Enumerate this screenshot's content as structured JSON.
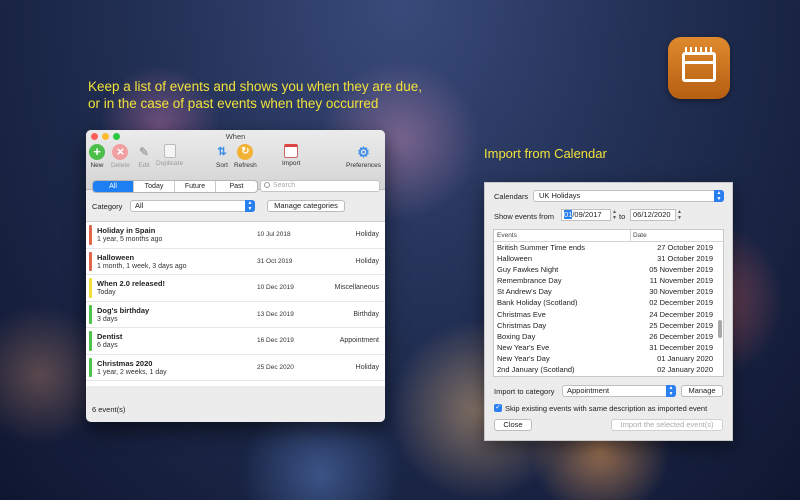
{
  "promo": {
    "headline_line1": "Keep a list of events and shows you when they are due,",
    "headline_line2": "or in the case of past events when they occurred",
    "import_heading": "Import from Calendar"
  },
  "app_icon": "calendar-icon",
  "colors": {
    "headline": "#f2e23a",
    "accent": "#1e7ff2",
    "app_icon": "#d2741f"
  },
  "main_window": {
    "title": "When",
    "toolbar": [
      {
        "label": "New",
        "icon": "plus-circle-icon",
        "enabled": true
      },
      {
        "label": "Delete",
        "icon": "x-circle-icon",
        "enabled": false
      },
      {
        "label": "Edit",
        "icon": "pencil-icon",
        "enabled": false
      },
      {
        "label": "Duplicate",
        "icon": "duplicate-icon",
        "enabled": false
      },
      {
        "label": "Sort",
        "icon": "sort-icon",
        "enabled": true
      },
      {
        "label": "Refresh",
        "icon": "refresh-icon",
        "enabled": true
      },
      {
        "label": "Import",
        "icon": "calendar-import-icon",
        "enabled": true
      },
      {
        "label": "Preferences",
        "icon": "gear-icon",
        "enabled": true
      }
    ],
    "filters": [
      "All",
      "Today",
      "Future",
      "Past"
    ],
    "active_filter": "All",
    "search_placeholder": "Search",
    "category_label": "Category",
    "category_value": "All",
    "manage_categories": "Manage categories",
    "events": [
      {
        "title": "Holiday in Spain",
        "relative": "1 year, 5 months ago",
        "date": "10 Jul 2018",
        "category": "Holiday",
        "color": "#e0664b"
      },
      {
        "title": "Halloween",
        "relative": "1 month, 1 week, 3 days ago",
        "date": "31 Oct 2019",
        "category": "Holiday",
        "color": "#e0664b"
      },
      {
        "title": "When 2.0 released!",
        "relative": "Today",
        "date": "10 Dec 2019",
        "category": "Miscellaneous",
        "color": "#f0de3a"
      },
      {
        "title": "Dog's birthday",
        "relative": "3 days",
        "date": "13 Dec 2019",
        "category": "Birthday",
        "color": "#4cc24a"
      },
      {
        "title": "Dentist",
        "relative": "6 days",
        "date": "16 Dec 2019",
        "category": "Appointment",
        "color": "#4cc24a"
      },
      {
        "title": "Christmas 2020",
        "relative": "1 year, 2 weeks, 1 day",
        "date": "25 Dec 2020",
        "category": "Holiday",
        "color": "#4cc24a"
      }
    ],
    "footer": "6 event(s)"
  },
  "import_window": {
    "calendars_label": "Calendars",
    "calendar_value": "UK Holidays",
    "show_events_label": "Show events from",
    "from_day_highlight": "01",
    "from_rest": "/09/2017",
    "to_label": "to",
    "to_date": "06/12/2020",
    "col_events": "Events",
    "col_date": "Date",
    "events": [
      {
        "name": "British Summer Time ends",
        "date": "27 October 2019"
      },
      {
        "name": "Halloween",
        "date": "31 October 2019"
      },
      {
        "name": "Guy Fawkes Night",
        "date": "05 November 2019"
      },
      {
        "name": "Remembrance Day",
        "date": "11 November 2019"
      },
      {
        "name": "St Andrew's Day",
        "date": "30 November 2019"
      },
      {
        "name": "Bank Holiday (Scotland)",
        "date": "02 December 2019"
      },
      {
        "name": "Christmas Eve",
        "date": "24 December 2019"
      },
      {
        "name": "Christmas Day",
        "date": "25 December 2019"
      },
      {
        "name": "Boxing Day",
        "date": "26 December 2019"
      },
      {
        "name": "New Year's Eve",
        "date": "31 December 2019"
      },
      {
        "name": "New Year's Day",
        "date": "01 January 2020"
      },
      {
        "name": "2nd January (Scotland)",
        "date": "02 January 2020"
      }
    ],
    "import_to_label": "Import to category",
    "import_category": "Appointment",
    "manage": "Manage",
    "skip_label": "Skip existing events with same description as imported event",
    "skip_checked": true,
    "close": "Close",
    "import_selected": "Import the selected event(s)"
  }
}
